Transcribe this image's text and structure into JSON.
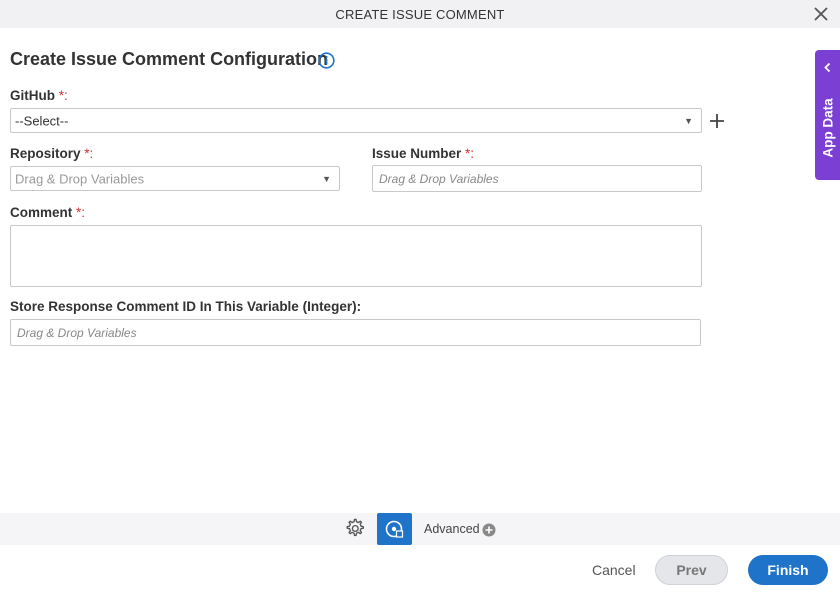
{
  "dialog": {
    "title": "CREATE ISSUE COMMENT",
    "close_icon": "close-icon"
  },
  "form": {
    "heading": "Create Issue Comment Configuration",
    "info_icon": "info-icon",
    "github": {
      "label": "GitHub",
      "required_mark": "*:",
      "value": "--Select--"
    },
    "repository": {
      "label": "Repository",
      "required_mark": "*:",
      "placeholder": "Drag & Drop Variables"
    },
    "issue_number": {
      "label": "Issue Number",
      "required_mark": "*:",
      "placeholder": "Drag & Drop Variables"
    },
    "comment": {
      "label": "Comment",
      "required_mark": "*:",
      "value": ""
    },
    "store_response": {
      "label": "Store Response Comment ID In This Variable (Integer):",
      "placeholder": "Drag & Drop Variables"
    }
  },
  "side_panel": {
    "label": "App Data"
  },
  "toolbar": {
    "advanced_label": "Advanced"
  },
  "footer": {
    "cancel_label": "Cancel",
    "prev_label": "Prev",
    "finish_label": "Finish"
  },
  "colors": {
    "accent": "#1f73c9",
    "app_data": "#7c3fd3",
    "required": "#d32f2f"
  }
}
